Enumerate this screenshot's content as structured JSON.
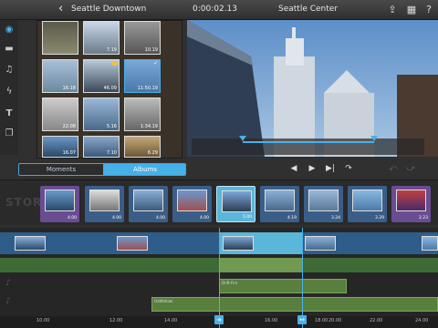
{
  "topbar": {
    "back_label": "Seattle Downtown",
    "timecode": "0:00:02.13",
    "project_title": "Seattle Center",
    "icons": [
      "share-icon",
      "settings-icon",
      "help-icon"
    ]
  },
  "tools": [
    "bluetooth-icon",
    "folder-icon",
    "music-icon",
    "lightning-icon",
    "text-icon",
    "copy-icon"
  ],
  "browser": {
    "thumbs": [
      {
        "dur": "",
        "tag": false,
        "chk": false
      },
      {
        "dur": "7.19",
        "tag": false,
        "chk": false
      },
      {
        "dur": "10.19",
        "tag": false,
        "chk": false
      },
      {
        "dur": "16.18",
        "tag": false,
        "chk": false
      },
      {
        "dur": "46.09",
        "tag": true,
        "chk": false
      },
      {
        "dur": "11:50.19",
        "tag": false,
        "chk": true
      },
      {
        "dur": "22.08",
        "tag": false,
        "chk": false
      },
      {
        "dur": "5.16",
        "tag": false,
        "chk": false
      },
      {
        "dur": "1:34.19",
        "tag": false,
        "chk": false
      },
      {
        "dur": "16.07",
        "tag": false,
        "chk": false
      },
      {
        "dur": "7.10",
        "tag": false,
        "chk": false
      },
      {
        "dur": "6.29",
        "tag": false,
        "chk": false
      }
    ]
  },
  "tabs": {
    "moments": "Moments",
    "albums": "Albums"
  },
  "transport": [
    "◀",
    "▶",
    "▶|",
    "↷",
    "⤺",
    "⤻"
  ],
  "storyboard": {
    "label": "STORY",
    "clips": [
      {
        "d": "4.00",
        "color": "#6a4c93"
      },
      {
        "d": "4.00",
        "color": "#3b5e88"
      },
      {
        "d": "4.00",
        "color": "#3b5e88"
      },
      {
        "d": "4.00",
        "color": "#3b5e88"
      },
      {
        "d": "5.00",
        "color": "#5ab7d9"
      },
      {
        "d": "4.19",
        "color": "#3b5e88"
      },
      {
        "d": "3.24",
        "color": "#3b5e88"
      },
      {
        "d": "3.29",
        "color": "#3b5e88"
      },
      {
        "d": "2.23",
        "color": "#6a4c93"
      }
    ]
  },
  "timeline": {
    "audio_clips": [
      "Doo-Ha",
      "Drift-Fire",
      "Oddfellow"
    ],
    "ruler": [
      "10.00",
      "12.00",
      "14.00",
      "16.00",
      "18.00",
      "20.00",
      "22.00",
      "24.00"
    ]
  }
}
